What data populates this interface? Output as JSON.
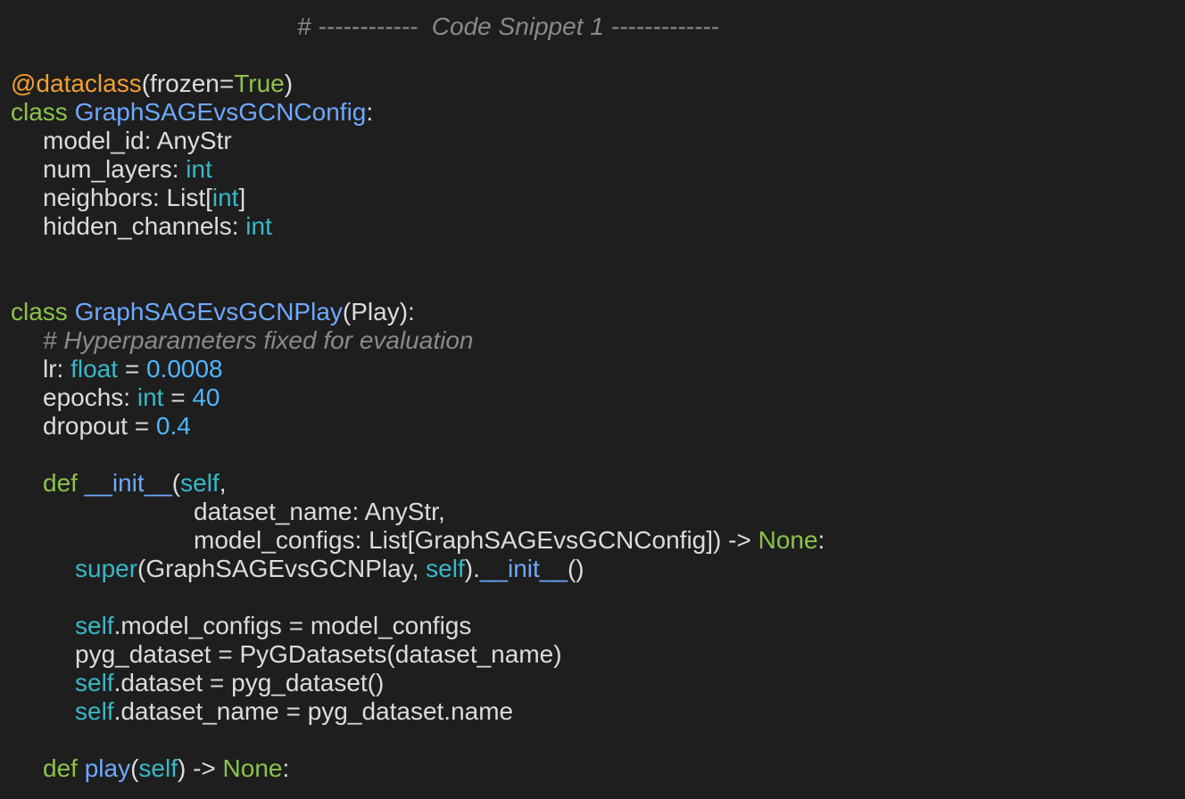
{
  "title_comment": "# ------------  Code Snippet 1 -------------",
  "lines": [
    [
      {
        "t": "@dataclass",
        "c": "dec"
      },
      {
        "t": "(frozen=",
        "c": "text"
      },
      {
        "t": "True",
        "c": "const"
      },
      {
        "t": ")",
        "c": "text"
      }
    ],
    [
      {
        "t": "class ",
        "c": "kw"
      },
      {
        "t": "GraphSAGEvsGCNConfig",
        "c": "cls"
      },
      {
        "t": ":",
        "c": "text"
      }
    ],
    [
      {
        "t": "model_id: AnyStr",
        "c": "text"
      }
    ],
    [
      {
        "t": "num_layers: ",
        "c": "text"
      },
      {
        "t": "int",
        "c": "builtin"
      }
    ],
    [
      {
        "t": "neighbors: List[",
        "c": "text"
      },
      {
        "t": "int",
        "c": "builtin"
      },
      {
        "t": "]",
        "c": "text"
      }
    ],
    [
      {
        "t": "hidden_channels: ",
        "c": "text"
      },
      {
        "t": "int",
        "c": "builtin"
      }
    ],
    [
      {
        "t": "class ",
        "c": "kw"
      },
      {
        "t": "GraphSAGEvsGCNPlay",
        "c": "cls"
      },
      {
        "t": "(Play):",
        "c": "text"
      }
    ],
    [
      {
        "t": "# Hyperparameters fixed for evaluation",
        "c": "comment"
      }
    ],
    [
      {
        "t": "lr: ",
        "c": "text"
      },
      {
        "t": "float",
        "c": "builtin"
      },
      {
        "t": " = ",
        "c": "text"
      },
      {
        "t": "0.0008",
        "c": "num"
      }
    ],
    [
      {
        "t": "epochs: ",
        "c": "text"
      },
      {
        "t": "int",
        "c": "builtin"
      },
      {
        "t": " = ",
        "c": "text"
      },
      {
        "t": "40",
        "c": "num"
      }
    ],
    [
      {
        "t": "dropout = ",
        "c": "text"
      },
      {
        "t": "0.4",
        "c": "num"
      }
    ],
    [
      {
        "t": "def ",
        "c": "kw"
      },
      {
        "t": "__init__",
        "c": "fn"
      },
      {
        "t": "(",
        "c": "text"
      },
      {
        "t": "self",
        "c": "builtin"
      },
      {
        "t": ",",
        "c": "text"
      }
    ],
    [
      {
        "t": "dataset_name: AnyStr,",
        "c": "text"
      }
    ],
    [
      {
        "t": "model_configs: List[GraphSAGEvsGCNConfig]) -> ",
        "c": "text"
      },
      {
        "t": "None",
        "c": "const"
      },
      {
        "t": ":",
        "c": "text"
      }
    ],
    [
      {
        "t": "super",
        "c": "builtin"
      },
      {
        "t": "(GraphSAGEvsGCNPlay, ",
        "c": "text"
      },
      {
        "t": "self",
        "c": "builtin"
      },
      {
        "t": ").",
        "c": "text"
      },
      {
        "t": "__init__",
        "c": "fn"
      },
      {
        "t": "()",
        "c": "text"
      }
    ],
    [
      {
        "t": "self",
        "c": "builtin"
      },
      {
        "t": ".model_configs = model_configs",
        "c": "text"
      }
    ],
    [
      {
        "t": "pyg_dataset = PyGDatasets(dataset_name)",
        "c": "text"
      }
    ],
    [
      {
        "t": "self",
        "c": "builtin"
      },
      {
        "t": ".dataset = pyg_dataset()",
        "c": "text"
      }
    ],
    [
      {
        "t": "self",
        "c": "builtin"
      },
      {
        "t": ".dataset_name = pyg_dataset.name",
        "c": "text"
      }
    ],
    [
      {
        "t": "def ",
        "c": "kw"
      },
      {
        "t": "play",
        "c": "fn"
      },
      {
        "t": "(",
        "c": "text"
      },
      {
        "t": "self",
        "c": "builtin"
      },
      {
        "t": ") -> ",
        "c": "text"
      },
      {
        "t": "None",
        "c": "const"
      },
      {
        "t": ":",
        "c": "text"
      }
    ]
  ]
}
